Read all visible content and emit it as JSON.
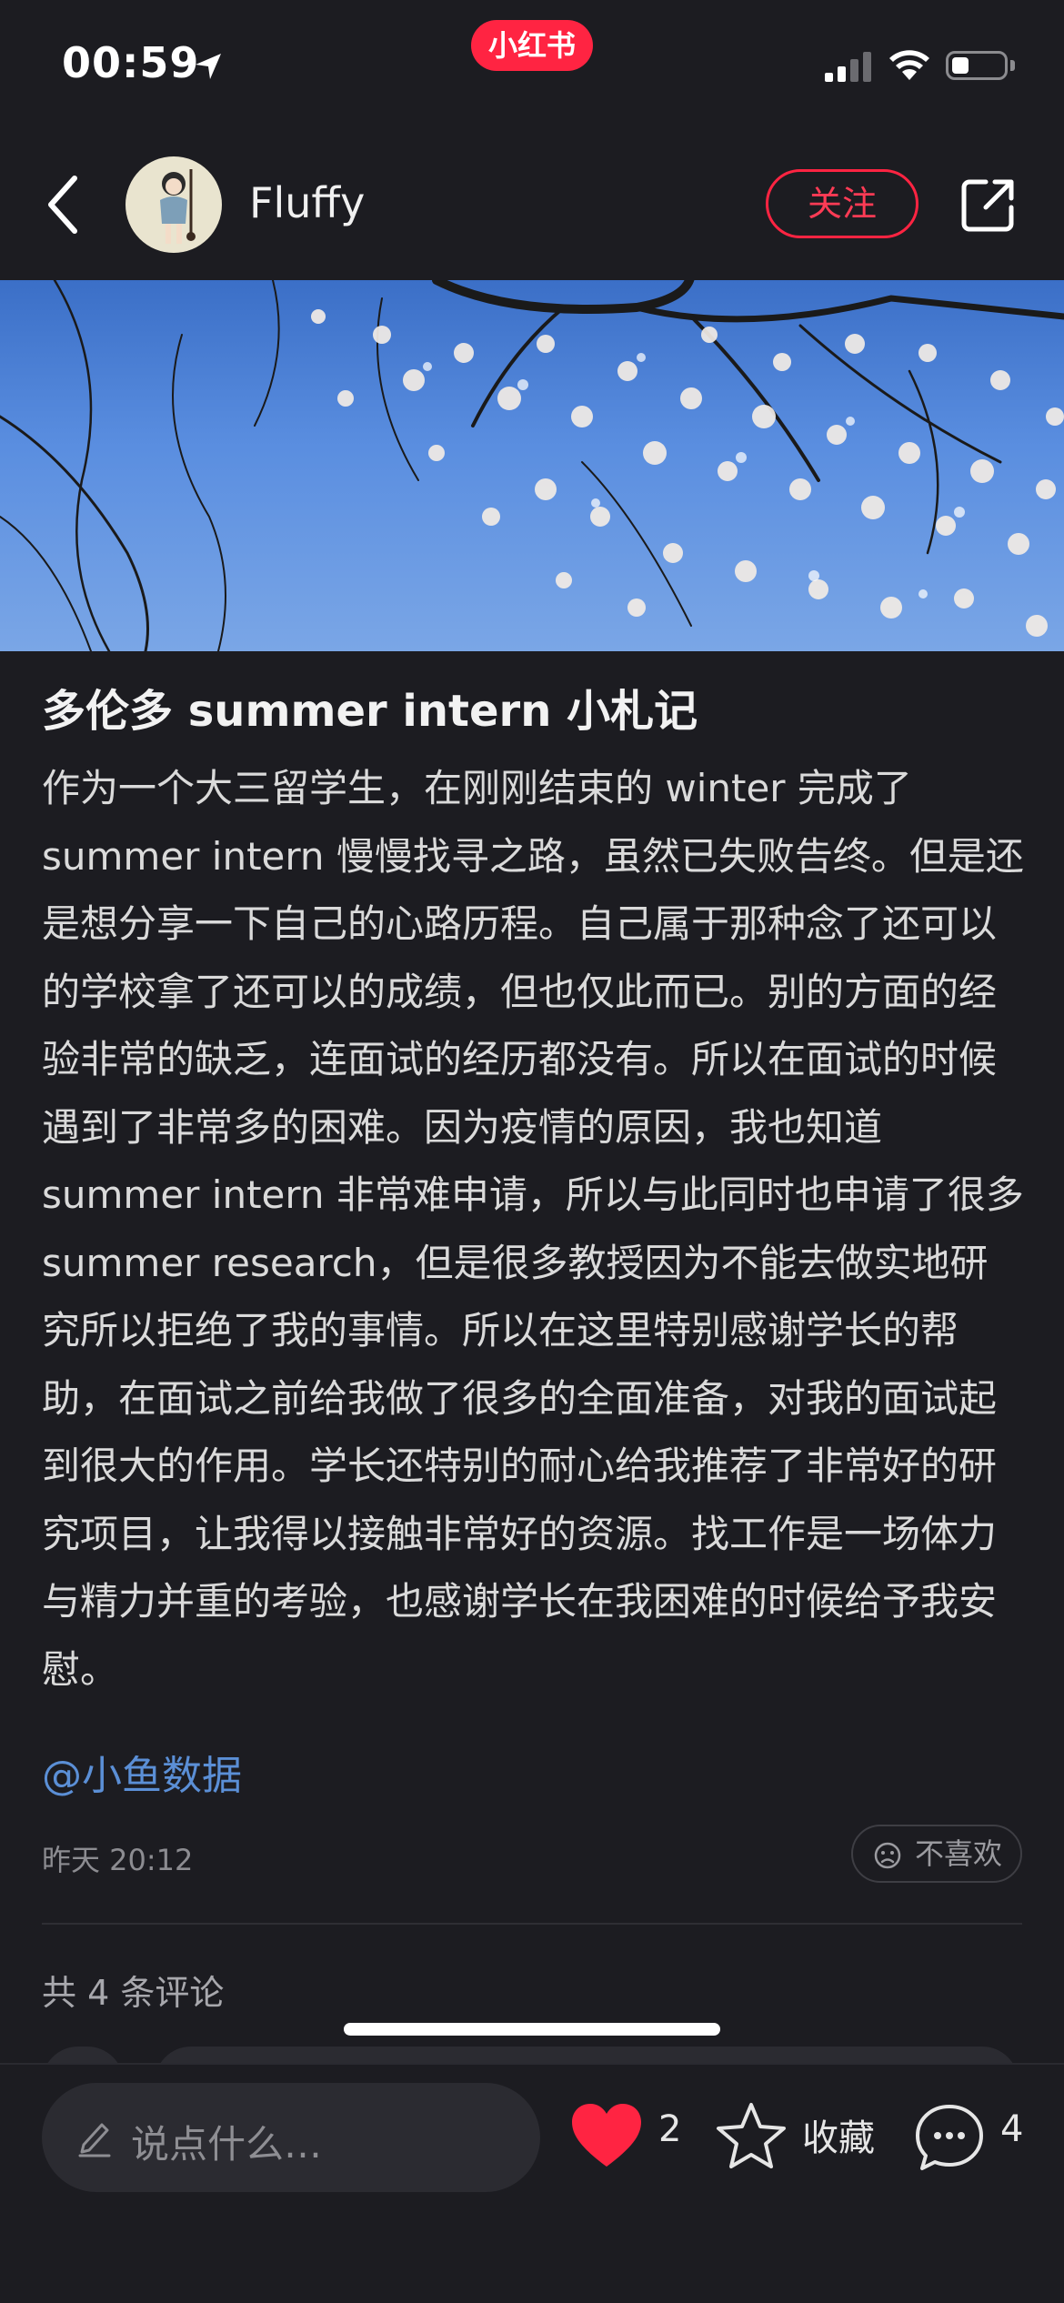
{
  "status_bar": {
    "time": "00:59",
    "app_badge": "小红书"
  },
  "header": {
    "username": "Fluffy",
    "follow_label": "关注"
  },
  "post": {
    "title": "多伦多 summer intern 小札记",
    "body": "作为一个大三留学生，在刚刚结束的 winter 完成了 summer intern 慢慢找寻之路，虽然已失败告终。但是还是想分享一下自己的心路历程。自己属于那种念了还可以的学校拿了还可以的成绩，但也仅此而已。别的方面的经验非常的缺乏，连面试的经历都没有。所以在面试的时候遇到了非常多的困难。因为疫情的原因，我也知道 summer intern 非常难申请，所以与此同时也申请了很多 summer research，但是很多教授因为不能去做实地研究所以拒绝了我的事情。所以在这里特别感谢学长的帮助，在面试之前给我做了很多的全面准备，对我的面试起到很大的作用。学长还特别的耐心给我推荐了非常好的研究项目，让我得以接触非常好的资源。找工作是一场体力与精力并重的考验，也感谢学长在我困难的时候给予我安慰。",
    "mention": "@小鱼数据",
    "date": "昨天 20:12",
    "dislike_label": "不喜欢",
    "comment_count_label": "共 4 条评论"
  },
  "bottom_bar": {
    "input_placeholder": "说点什么…",
    "like_count": "2",
    "collect_label": "收藏",
    "comment_count": "4"
  },
  "colors": {
    "accent": "#ff2442",
    "background": "#1c1c21",
    "link": "#5b8fd6"
  }
}
